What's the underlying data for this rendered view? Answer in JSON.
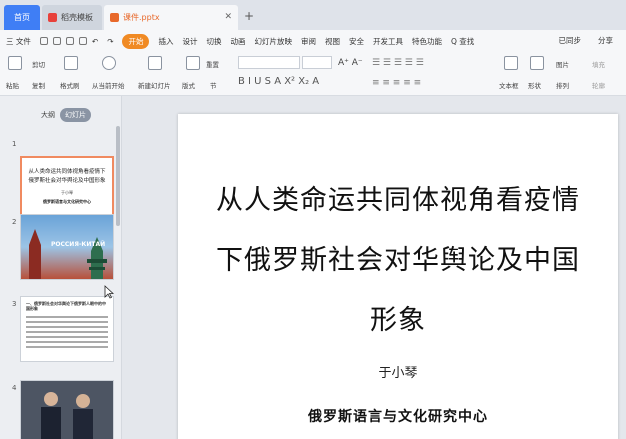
{
  "tabs": {
    "home": "首页",
    "template": "稻壳模板",
    "file": "课件.pptx"
  },
  "menu": {
    "file": "三 文件",
    "start": "开始",
    "items": [
      "插入",
      "设计",
      "切换",
      "动画",
      "幻灯片放映",
      "审阅",
      "视图",
      "安全",
      "开发工具",
      "特色功能"
    ],
    "search": "Q 查找",
    "sync": "已同步",
    "share": "分享"
  },
  "ribbon": {
    "paste": "粘贴",
    "cut": "剪切",
    "copy": "复制",
    "format_painter": "格式刷",
    "play_from_current": "从当前开始",
    "new_slide": "新建幻灯片",
    "layout": "版式",
    "section": "节",
    "reset": "重置",
    "textbox": "文本框",
    "shape": "形状",
    "arrange": "排列",
    "picture": "图片",
    "fill": "填充",
    "outline": "轮廓"
  },
  "panel": {
    "outline_tab": "大纲",
    "slides_tab": "幻灯片",
    "thumbs": [
      {
        "num": "1",
        "title": "从人类命运共同体视角看疫情下俄罗斯社会对华舆论及中国形象",
        "author": "于小琴",
        "org": "俄罗斯语言与文化研究中心"
      },
      {
        "num": "2",
        "caption": "РОССИЯ-КИТАЙ"
      },
      {
        "num": "3",
        "heading": "一、俄罗斯社会对华舆论下俄罗斯人眼中的中国形象"
      },
      {
        "num": "4"
      }
    ]
  },
  "slide": {
    "title_lines": [
      "从人类命运共同体视角看疫情",
      "下俄罗斯社会对华舆论及中国",
      "形象"
    ],
    "author": "于小琴",
    "org": "俄罗斯语言与文化研究中心"
  },
  "colors": {
    "accent": "#3f7ef5",
    "start": "#f08a24"
  }
}
